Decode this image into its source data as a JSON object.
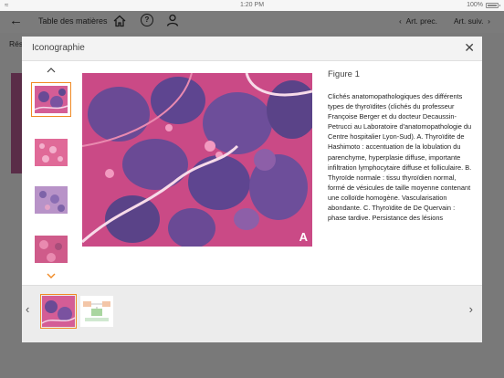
{
  "status_bar": {
    "time": "1:20 PM",
    "battery": "100%"
  },
  "nav": {
    "title": "Table des matières",
    "prev": "Art. prec.",
    "next": "Art. suiv."
  },
  "background": {
    "section_label": "Rés"
  },
  "modal": {
    "title": "Iconographie",
    "figure_title": "Figure 1",
    "image_letter": "A",
    "caption": "Clichés anatomopathologiques des différents types de thyroïdites (clichés du professeur Françoise Berger et du docteur Decaussin-Petrucci au Laboratoire d'anatomopathologie du Centre hospitalier Lyon-Sud). A. Thyroïdite de Hashimoto : accentuation de la lobulation du parenchyme, hyperplasie diffuse, importante infiltration lymphocytaire diffuse et folliculaire. B. Thyroïde normale : tissu thyroïdien normal, formé de vésicules de taille moyenne contenant une colloïde homogène. Vascularisation abondante. C. Thyroïdite de De Quervain : phase tardive. Persistance des lésions"
  },
  "colors": {
    "accent": "#f08a24",
    "tissue_pink": "#d4558f",
    "tissue_purple": "#6a4a95"
  },
  "icons": [
    "wifi-icon",
    "battery-icon",
    "back-arrow-icon",
    "home-icon",
    "help-icon",
    "user-icon",
    "close-icon",
    "chevron-up-icon",
    "chevron-down-icon",
    "chevron-left-icon",
    "chevron-right-icon"
  ]
}
